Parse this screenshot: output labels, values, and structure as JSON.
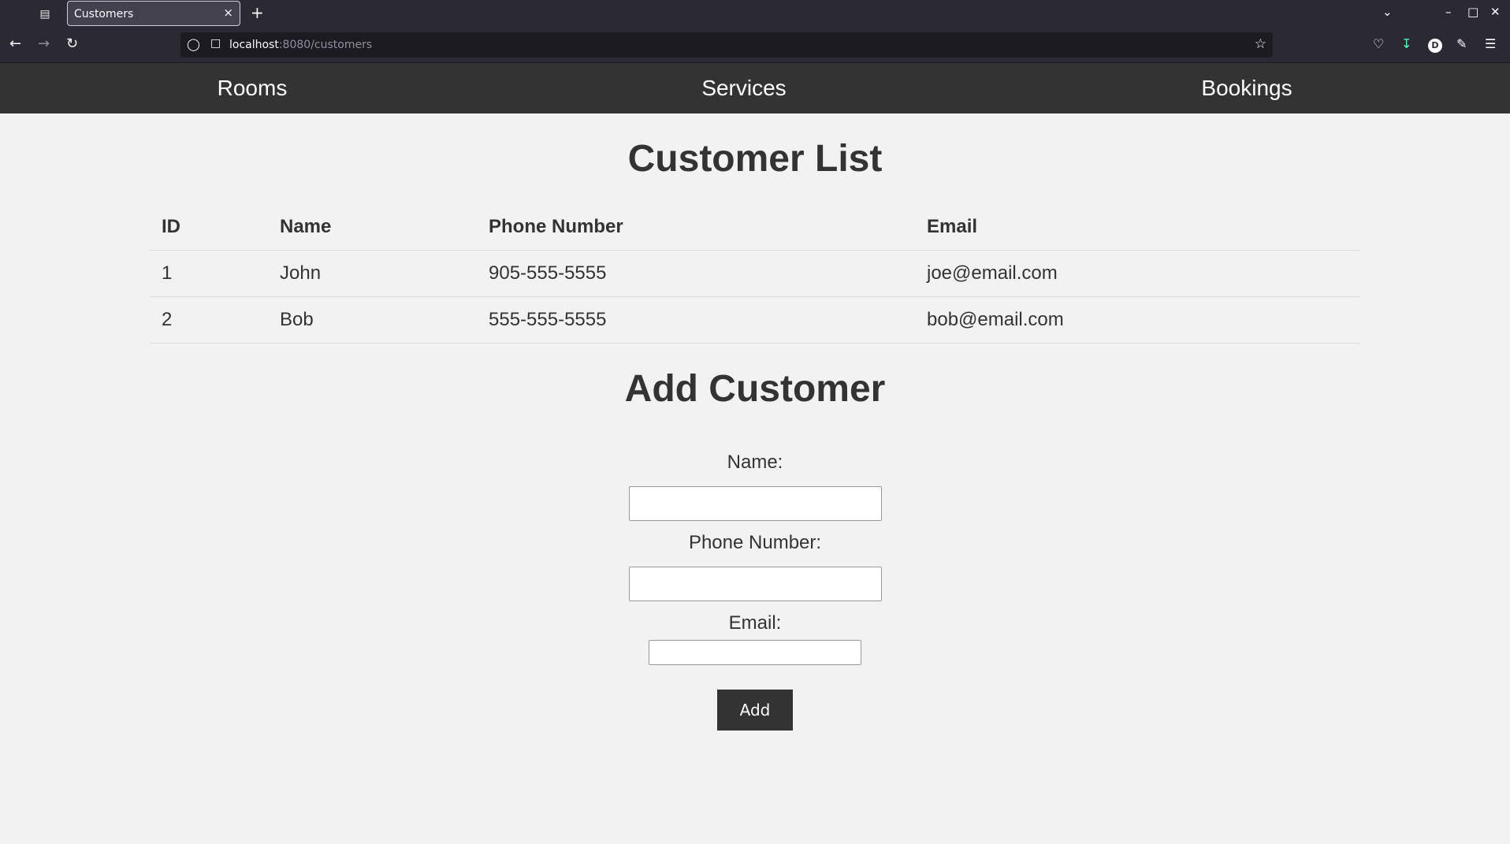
{
  "browser": {
    "tab_title": "Customers",
    "tab_close": "×",
    "new_tab": "+",
    "url_host": "localhost",
    "url_rest": ":8080/customers",
    "avatar_letter": "D"
  },
  "nav": {
    "items": [
      {
        "label": "Rooms"
      },
      {
        "label": "Services"
      },
      {
        "label": "Bookings"
      }
    ]
  },
  "customer_list": {
    "title": "Customer List",
    "columns": [
      "ID",
      "Name",
      "Phone Number",
      "Email"
    ],
    "rows": [
      [
        "1",
        "John",
        "905-555-5555",
        "joe@email.com"
      ],
      [
        "2",
        "Bob",
        "555-555-5555",
        "bob@email.com"
      ]
    ]
  },
  "add_customer": {
    "title": "Add Customer",
    "name_label": "Name:",
    "name_value": "",
    "phone_label": "Phone Number:",
    "phone_value": "",
    "email_label": "Email:",
    "email_value": "",
    "submit_label": "Add"
  },
  "colors": {
    "nav_background": "#333333",
    "page_background": "#f2f2f2",
    "button_background": "#333333"
  },
  "icons": [
    "tab-list-icon",
    "back-icon",
    "forward-icon",
    "reload-icon",
    "shield-icon",
    "page-icon",
    "bookmark-star-icon",
    "pocket-icon",
    "download-icon",
    "extensions-icon",
    "menu-icon",
    "chevron-down-icon",
    "minimize-icon",
    "maximize-icon",
    "close-window-icon"
  ]
}
